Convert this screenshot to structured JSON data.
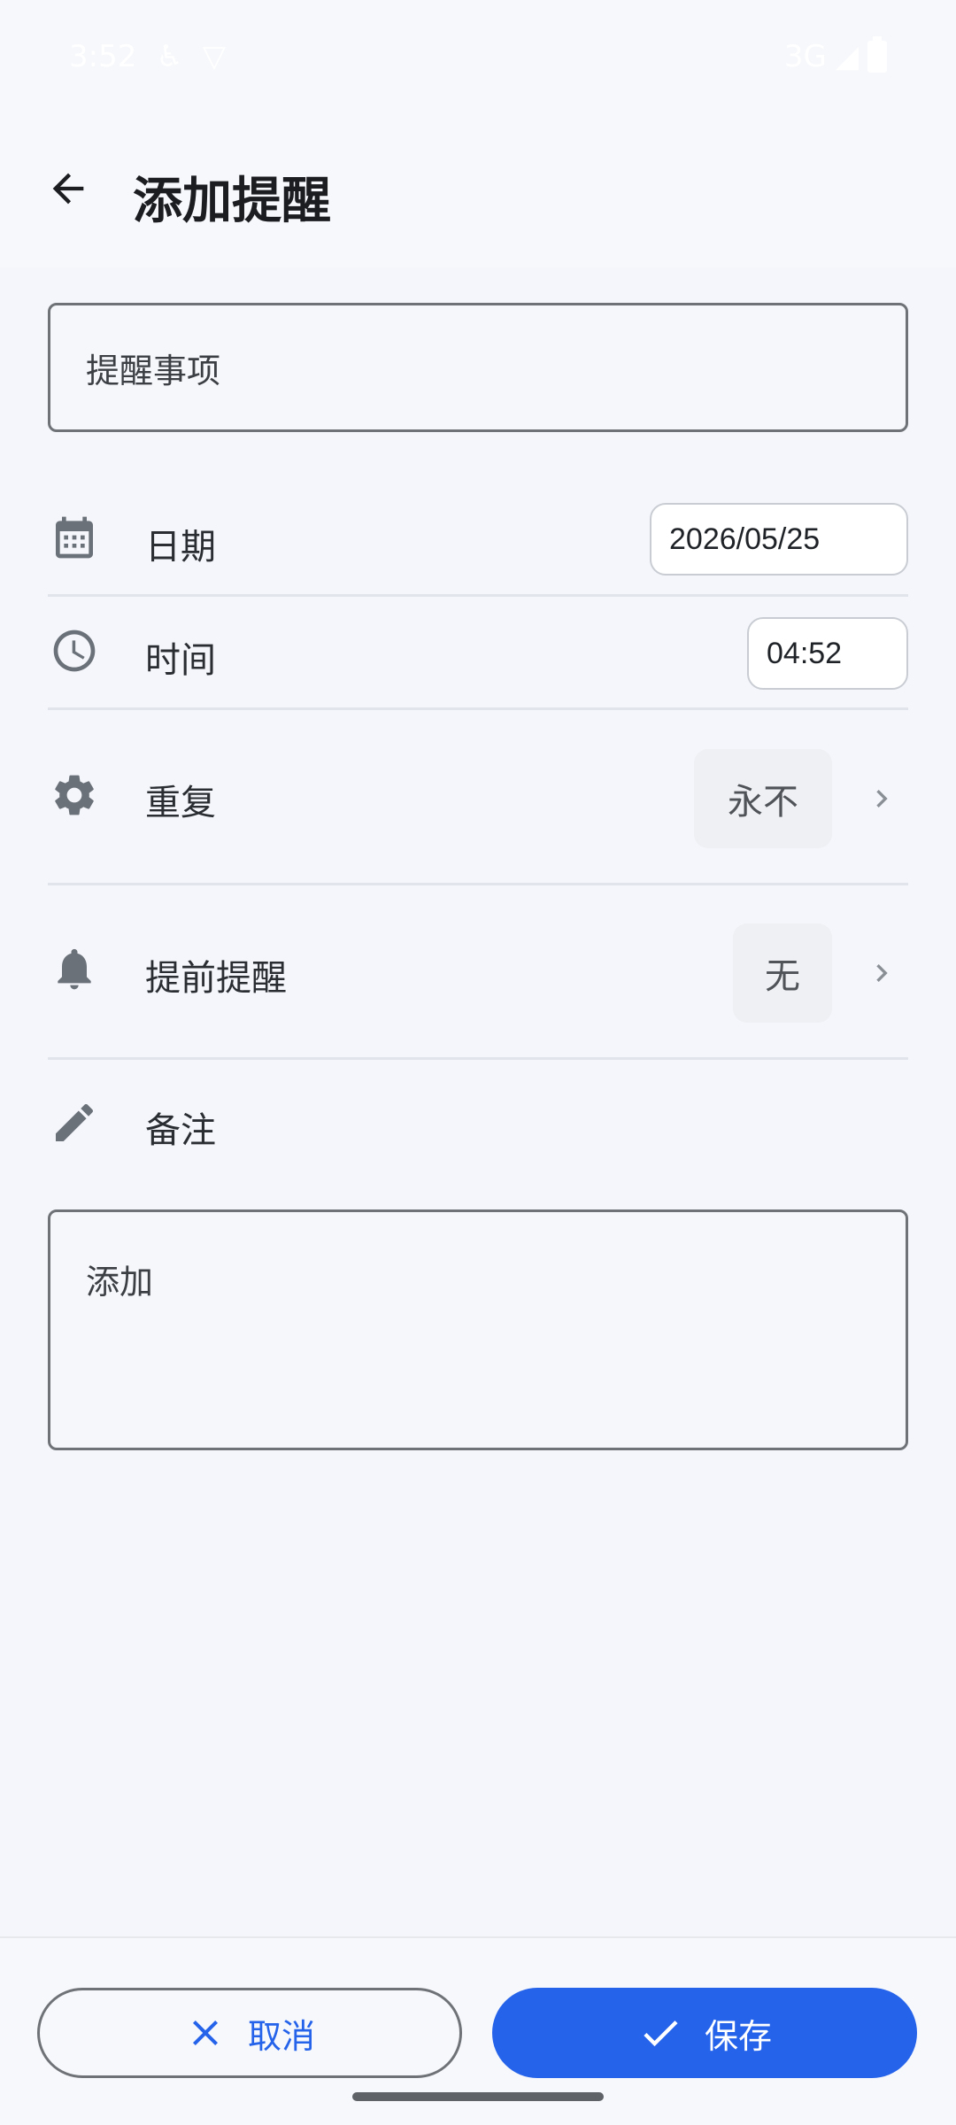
{
  "status_bar": {
    "time": "3:52",
    "network": "3G"
  },
  "header": {
    "title": "添加提醒"
  },
  "form": {
    "title_placeholder": "提醒事项",
    "date": {
      "label": "日期",
      "value": "2026/05/25"
    },
    "time": {
      "label": "时间",
      "value": "04:52"
    },
    "repeat": {
      "label": "重复",
      "value": "永不"
    },
    "advance": {
      "label": "提前提醒",
      "value": "无"
    },
    "notes": {
      "label": "备注",
      "placeholder": "添加"
    }
  },
  "actions": {
    "cancel": "取消",
    "save": "保存"
  },
  "colors": {
    "accent": "#2563eb",
    "icon": "#6b7178",
    "background": "#f4f6fb"
  }
}
